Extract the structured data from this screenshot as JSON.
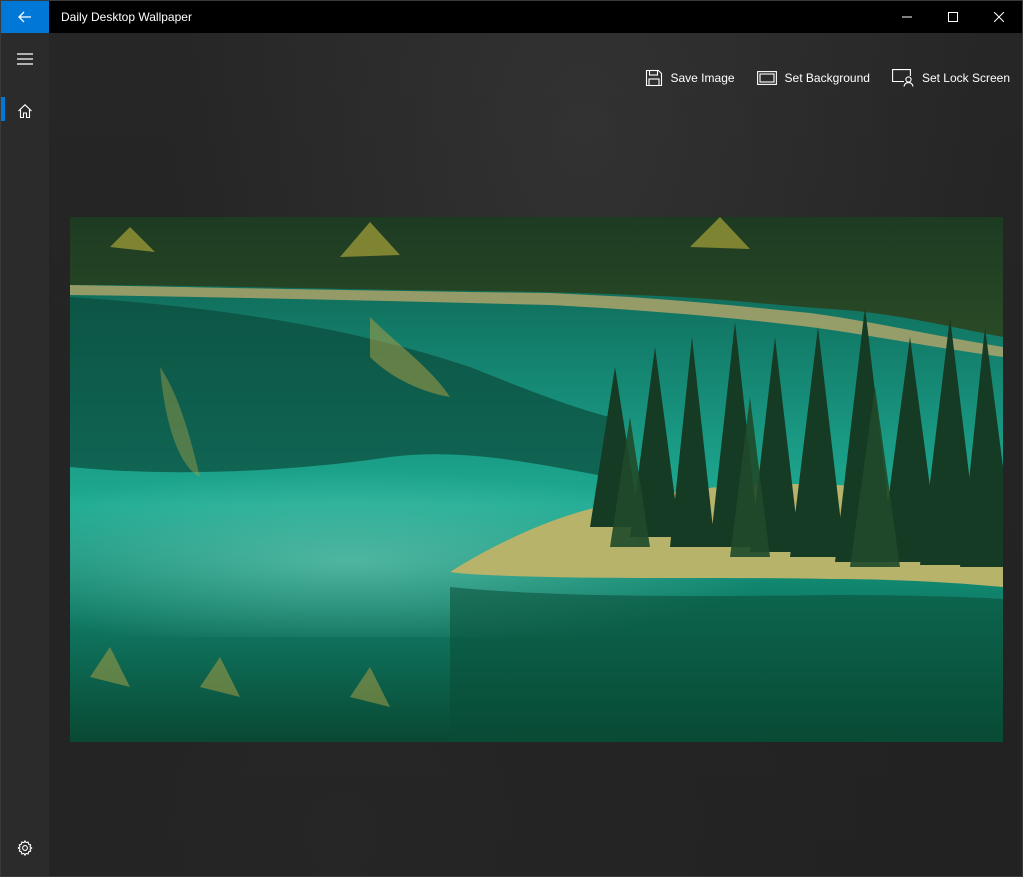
{
  "window": {
    "title": "Daily Desktop Wallpaper",
    "accent_color": "#0078d7",
    "caption_buttons": [
      "minimize",
      "maximize",
      "close"
    ]
  },
  "nav": {
    "items": [
      {
        "icon": "hamburger-menu-icon"
      },
      {
        "icon": "home-icon",
        "selected": true
      }
    ],
    "footer_icon": "settings-gear-icon"
  },
  "toolbar": {
    "save_label": "Save Image",
    "background_label": "Set Background",
    "lockscreen_label": "Set Lock Screen"
  },
  "wallpaper": {
    "subject": "turquoise lake with evergreen forest island and reflections"
  }
}
